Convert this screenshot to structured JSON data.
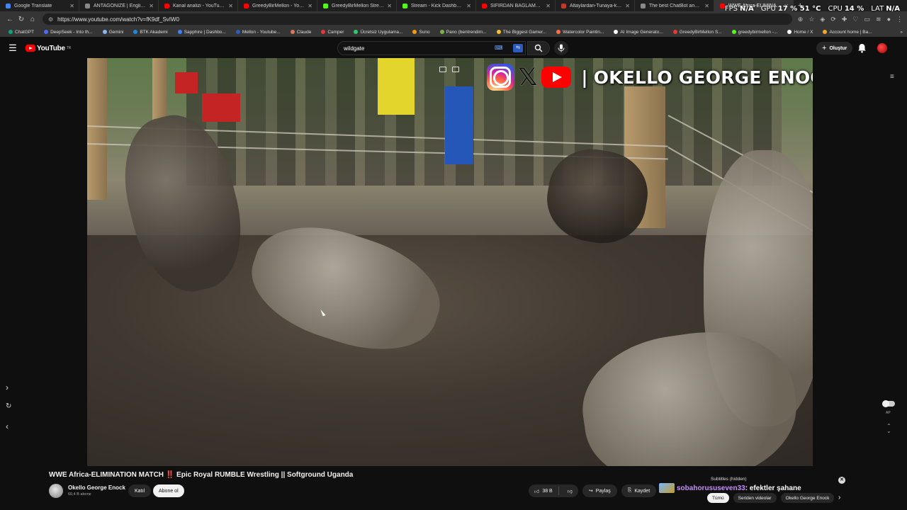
{
  "browser": {
    "tabs": [
      {
        "title": "Google Translate",
        "color": "#4285f4"
      },
      {
        "title": "ANTAGONIZE | English meaning",
        "color": "#888888"
      },
      {
        "title": "Kanal analizi - YouTube Studio",
        "color": "#ff0000"
      },
      {
        "title": "GreedyBirMellon - YouTube",
        "color": "#ff0000"
      },
      {
        "title": "GreedyBirMellon Stream - Watch",
        "color": "#53fc18"
      },
      {
        "title": "Stream - Kick Dashboard",
        "color": "#53fc18"
      },
      {
        "title": "SIFIRDAN BAĞLAMA DERSLERİ",
        "color": "#ff0000"
      },
      {
        "title": "Altaylardan-Tunaya-kolay-nota",
        "color": "#c0392b"
      },
      {
        "title": "The best ChatBot and Widgets",
        "color": "#888888"
      },
      {
        "title": "WWE Africa-ELIMINATION",
        "color": "#ff0000"
      }
    ],
    "url": "https://www.youtube.com/watch?v=fK9df_SvIW0",
    "bookmarks": [
      {
        "label": "ChatGPT",
        "color": "#10a37f"
      },
      {
        "label": "DeepSeek - Into th...",
        "color": "#4d6bfe"
      },
      {
        "label": "Gemini",
        "color": "#8ab4f8"
      },
      {
        "label": "BTK Akademi",
        "color": "#1e88e5"
      },
      {
        "label": "Sapphire | Dashbo...",
        "color": "#3b82f6"
      },
      {
        "label": "Mellon - Youtube...",
        "color": "#2c5bbd"
      },
      {
        "label": "Claude",
        "color": "#d97757"
      },
      {
        "label": "Camper",
        "color": "#e53935"
      },
      {
        "label": "Ücretsiz Uygulama...",
        "color": "#2ecc71"
      },
      {
        "label": "Suno",
        "color": "#f39c12"
      },
      {
        "label": "Pano (bentrendim...",
        "color": "#7cb342"
      },
      {
        "label": "The Biggest Gamer...",
        "color": "#fbc02d"
      },
      {
        "label": "Watercolor Paintin...",
        "color": "#ff7043"
      },
      {
        "label": "AI Image Generato...",
        "color": "#ffffff"
      },
      {
        "label": "GreedyBirMellon S...",
        "color": "#e53935"
      },
      {
        "label": "greedybirmellon -...",
        "color": "#53fc18"
      },
      {
        "label": "Home / X",
        "color": "#ffffff"
      },
      {
        "label": "Account home | Ba...",
        "color": "#f5a623"
      }
    ],
    "all_bookmarks_icon": "chevron-right-double"
  },
  "perf": {
    "fps_label": "FPS",
    "fps_value": "N/A",
    "gpu_label": "GPU",
    "gpu_value": "17 % 51 °C",
    "cpu_label": "CPU",
    "cpu_value": "14 %",
    "lat_label": "LAT",
    "lat_value": "N/A"
  },
  "youtube": {
    "logo_text": "YouTube",
    "logo_region": "TR",
    "search_value": "wildgate",
    "create_label": "Oluştur",
    "video": {
      "watermark_text": "OKELLO GEORGE ENOCK",
      "watermark_separator": "|"
    },
    "title_main": "WWE Africa-ELIMINATION MATCH",
    "title_warn": "‼️",
    "title_rest": "Epic Royal RUMBLE Wrestling || Softground Uganda",
    "channel_name": "Okello George Enock",
    "channel_subs": "60,4 B abone",
    "join_label": "Katıl",
    "subscribe_label": "Abone ol",
    "likes": "38 B",
    "share_label": "Paylaş",
    "save_label": "Kaydet",
    "subtitles_label": "Subtitles (hidden)",
    "chat_user": "sobahorususeven33",
    "chat_message": " : efektler şahane",
    "chips": [
      "Tümü",
      "Seriden videolar",
      "Okello George Enock"
    ],
    "ap_label": "AP"
  }
}
